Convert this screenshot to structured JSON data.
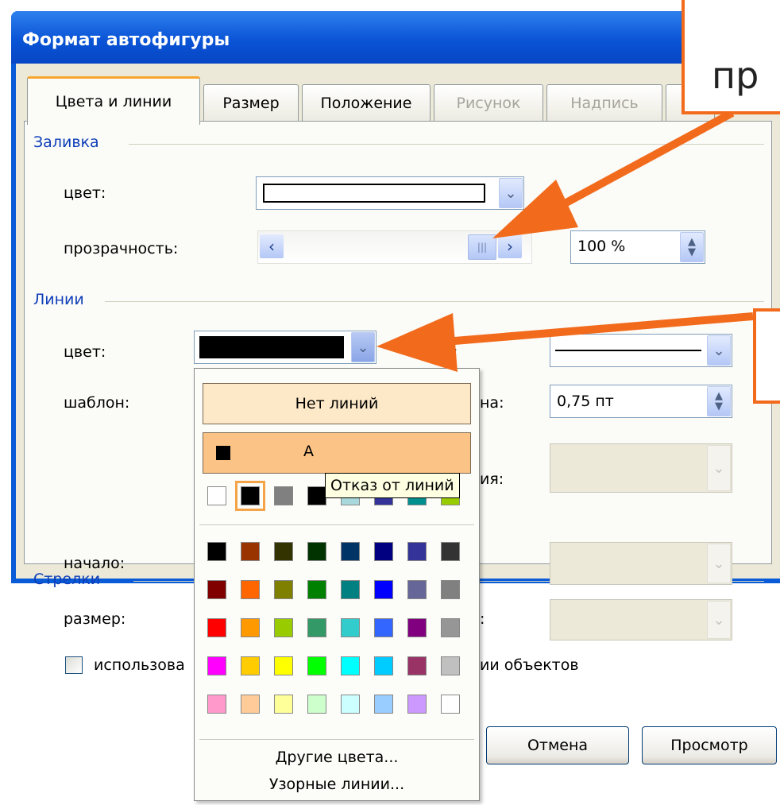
{
  "dialog": {
    "title": "Формат автофигуры",
    "tabs": [
      {
        "label": "Цвета и линии",
        "active": true,
        "enabled": true
      },
      {
        "label": "Размер",
        "active": false,
        "enabled": true
      },
      {
        "label": "Положение",
        "active": false,
        "enabled": true
      },
      {
        "label": "Рисунок",
        "active": false,
        "enabled": false
      },
      {
        "label": "Надпись",
        "active": false,
        "enabled": false
      }
    ],
    "fill": {
      "group_label": "Заливка",
      "color_label": "цвет:",
      "color_value": "#ffffff",
      "transparency_label": "прозрачность:",
      "transparency_value": "100 %",
      "transparency_fraction": 1.0
    },
    "lines": {
      "group_label": "Линии",
      "color_label": "цвет:",
      "color_value": "#000000",
      "pattern_label": "шаблон:",
      "weight_label_tail": "на:",
      "weight_value": "0,75 пт",
      "connector_label_tail": "ия:",
      "type_label_tail": ":"
    },
    "arrows": {
      "group_label": "Стрелки",
      "start_label": "начало:",
      "size_label": "размер:",
      "size_right_tail": ":"
    },
    "checkbox_text_left": "использова",
    "checkbox_text_right": "ии объектов",
    "buttons": {
      "cancel": "Отмена",
      "preview": "Просмотр"
    }
  },
  "color_popup": {
    "no_line_label": "Нет линий",
    "automatic_label_fragment": "А",
    "tooltip": "Отказ от линий",
    "recent_colors": [
      "#ffffff",
      "#000000",
      "#808080",
      "#000000",
      "#a8d8dc",
      "#333399",
      "#008f8f",
      "#99cc00"
    ],
    "palette": [
      [
        "#000000",
        "#993300",
        "#333300",
        "#003300",
        "#003366",
        "#000080",
        "#333399",
        "#333333"
      ],
      [
        "#800000",
        "#ff6600",
        "#808000",
        "#008000",
        "#008080",
        "#0000ff",
        "#666699",
        "#808080"
      ],
      [
        "#ff0000",
        "#ff9900",
        "#99cc00",
        "#339966",
        "#33cccc",
        "#3366ff",
        "#800080",
        "#969696"
      ],
      [
        "#ff00ff",
        "#ffcc00",
        "#ffff00",
        "#00ff00",
        "#00ffff",
        "#00ccff",
        "#993366",
        "#c0c0c0"
      ],
      [
        "#ff99cc",
        "#ffcc99",
        "#ffff99",
        "#ccffcc",
        "#ccffff",
        "#99ccff",
        "#cc99ff",
        "#ffffff"
      ]
    ],
    "more_colors": "Другие цвета...",
    "patterned_lines": "Узорные линии..."
  },
  "annotations": {
    "callout1_text": "пр",
    "callout2_text": "",
    "accent": "#f26b1c"
  }
}
